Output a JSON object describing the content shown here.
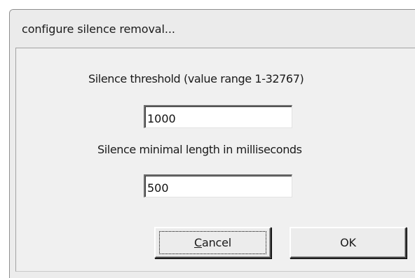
{
  "window": {
    "title": "configure silence removal..."
  },
  "form": {
    "threshold_label": "Silence threshold (value range 1-32767)",
    "threshold_value": "1000",
    "min_length_label": "Silence minimal length in milliseconds",
    "min_length_value": "500"
  },
  "buttons": {
    "cancel_mnemonic": "C",
    "cancel_rest": "ancel",
    "ok_label": "OK"
  },
  "colors": {
    "dialog_background": "#f0f0f0",
    "title_bar": "#ebebeb",
    "field_background": "#ffffff"
  }
}
